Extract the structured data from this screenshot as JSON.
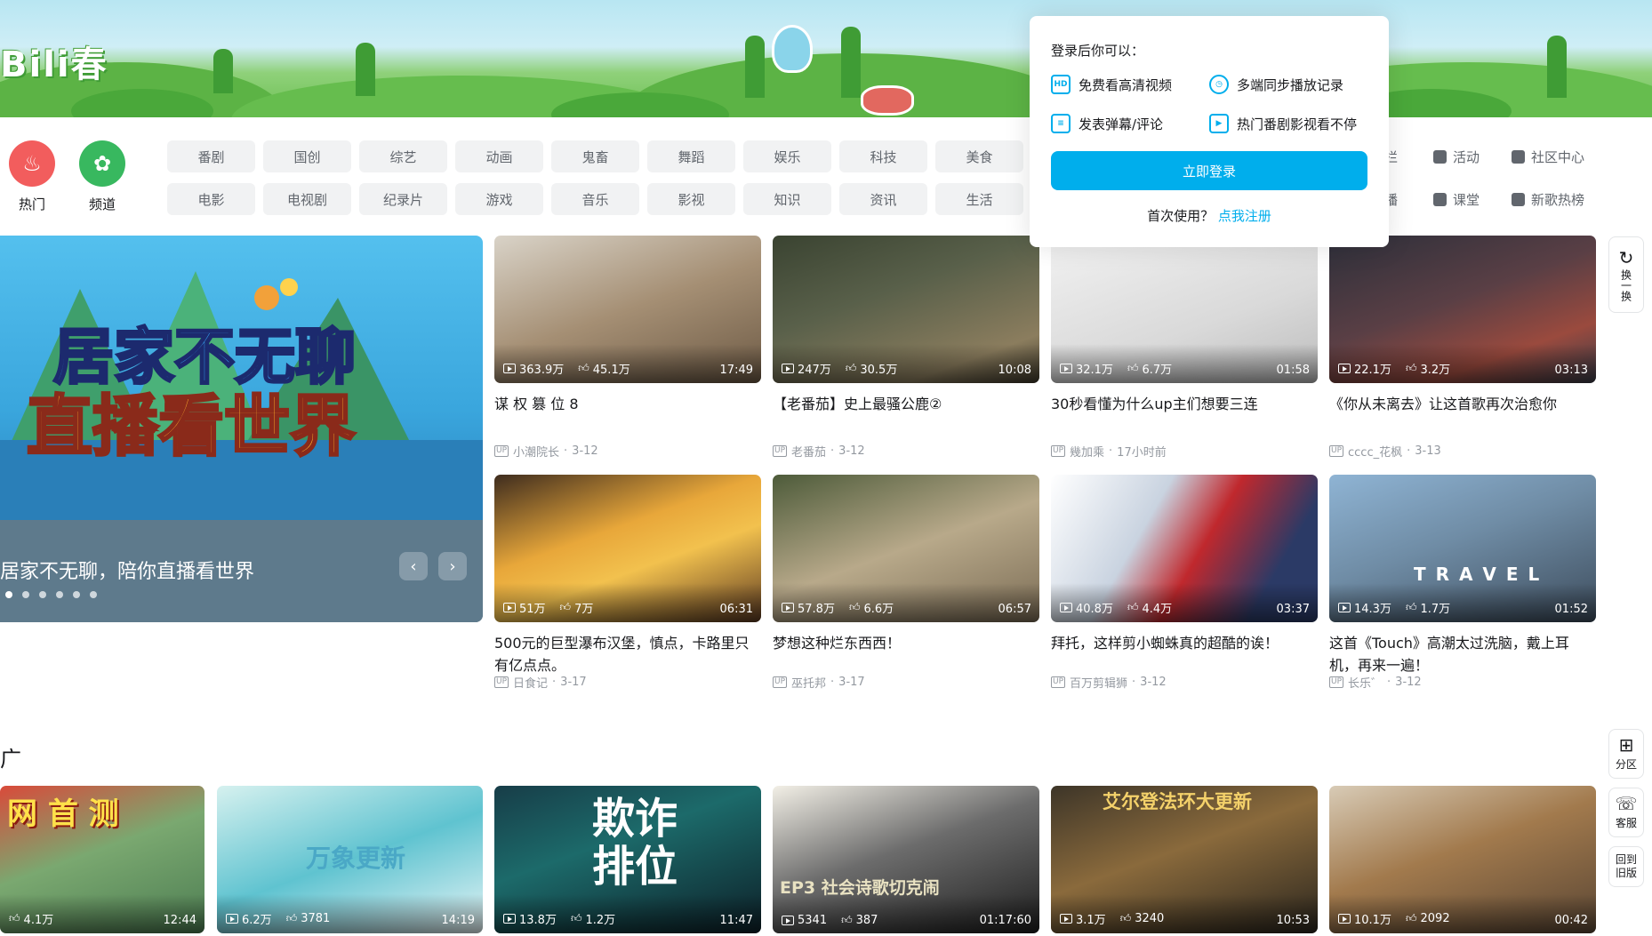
{
  "banner": {
    "logo": "Bili春"
  },
  "nav": {
    "hot_label": "热门",
    "channel_label": "频道",
    "categories": [
      "番剧",
      "国创",
      "综艺",
      "动画",
      "鬼畜",
      "舞蹈",
      "娱乐",
      "科技",
      "美食",
      "电影",
      "电视剧",
      "纪录片",
      "游戏",
      "音乐",
      "影视",
      "知识",
      "资讯",
      "生活"
    ],
    "right_links": [
      "专栏",
      "活动",
      "社区中心",
      "直播",
      "课堂",
      "新歌热榜"
    ]
  },
  "carousel": {
    "art_line1": "居家不无聊",
    "art_line2": "直播看世界",
    "caption": "居家不无聊，陪你直播看世界",
    "prev": "‹",
    "next": "›"
  },
  "videos": [
    {
      "plays": "363.9万",
      "likes": "45.1万",
      "duration": "17:49",
      "title": "谋 权 篡 位 8",
      "author": "小潮院长",
      "date": "3-12"
    },
    {
      "plays": "247万",
      "likes": "30.5万",
      "duration": "10:08",
      "title": "【老番茄】史上最骚公鹿②",
      "author": "老番茄",
      "date": "3-12"
    },
    {
      "plays": "32.1万",
      "likes": "6.7万",
      "duration": "01:58",
      "title": "30秒看懂为什么up主们想要三连",
      "author": "幾加乘",
      "date": "17小时前"
    },
    {
      "plays": "22.1万",
      "likes": "3.2万",
      "duration": "03:13",
      "title": "《你从未离去》让这首歌再次治愈你",
      "author": "cccc_花枫",
      "date": "3-13"
    },
    {
      "plays": "51万",
      "likes": "7万",
      "duration": "06:31",
      "title": "500元的巨型瀑布汉堡，慎点，卡路里只有亿点点。",
      "author": "日食记",
      "date": "3-17"
    },
    {
      "plays": "57.8万",
      "likes": "6.6万",
      "duration": "06:57",
      "title": "梦想这种烂东西西！",
      "author": "巫托邦",
      "date": "3-17"
    },
    {
      "plays": "40.8万",
      "likes": "4.4万",
      "duration": "03:37",
      "title": "拜托，这样剪小蜘蛛真的超酷的诶！",
      "author": "百万剪辑狮",
      "date": "3-12"
    },
    {
      "plays": "14.3万",
      "likes": "1.7万",
      "duration": "01:52",
      "title": "这首《Touch》高潮太过洗脑，戴上耳机，再来一遍！",
      "author": "长乐゛",
      "date": "3-12"
    }
  ],
  "travel_text": "T R A V E L",
  "section_title": "广",
  "bottom_videos": [
    {
      "plays": "4.1万",
      "likes": "",
      "duration": "12:44",
      "overlay": "网 首 测"
    },
    {
      "plays": "6.2万",
      "likes": "3781",
      "duration": "14:19",
      "overlay": "万象更新"
    },
    {
      "plays": "13.8万",
      "likes": "1.2万",
      "duration": "11:47",
      "overlay": "欺诈排位"
    },
    {
      "plays": "5341",
      "likes": "387",
      "duration": "01:17:60",
      "overlay": "EP3 社会诗歌切克闹"
    },
    {
      "plays": "3.1万",
      "likes": "3240",
      "duration": "10:53",
      "overlay": "艾尔登法环大更新"
    },
    {
      "plays": "10.1万",
      "likes": "2092",
      "duration": "00:42",
      "overlay": ""
    }
  ],
  "popup": {
    "title": "登录后你可以：",
    "features": [
      "免费看高清视频",
      "多端同步播放记录",
      "发表弹幕/评论",
      "热门番剧影视看不停"
    ],
    "login_button": "立即登录",
    "register_prompt": "首次使用？",
    "register_link": "点我注册"
  },
  "tools": {
    "refresh": "换一换",
    "section": "分区",
    "service": "客服",
    "old": "回到旧版"
  },
  "colors": {
    "accent": "#00aeec",
    "hot": "#f25d5d",
    "channel": "#38b85f"
  }
}
